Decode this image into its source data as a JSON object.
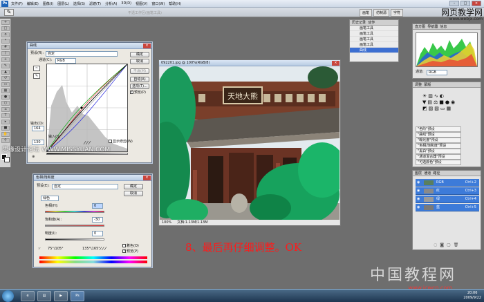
{
  "menubar": {
    "logo": "Ps",
    "menus": [
      "文件(F)",
      "编辑(E)",
      "图像(I)",
      "图层(L)",
      "选择(S)",
      "滤镜(T)",
      "分析(A)",
      "3D(D)",
      "视图(V)",
      "窗口(W)",
      "帮助(H)"
    ],
    "minimize": "–",
    "maximize": "□",
    "close": "×"
  },
  "optbar": {
    "brush_icon": "brush-icon",
    "hint": "不透工作区(画笔工具)",
    "tabs": [
      "画笔",
      "仿制源",
      "字符"
    ]
  },
  "site_watermark": {
    "title": "网页教学网",
    "url": "www.webjx.com"
  },
  "overlay_watermark": "思缘设计论坛 WWW.MISSYUAN.COM",
  "curves": {
    "title": "曲线",
    "preset_label": "预设(R):",
    "preset_value": "自定",
    "channel_label": "通道(C):",
    "channel_value": "RGB",
    "output_label": "输出(O):",
    "output_value": "164",
    "input_label": "输入(I):",
    "input_value": "130",
    "show_clipping": "显示修剪(W)",
    "buttons": {
      "ok": "确定",
      "cancel": "取消",
      "smooth": "平滑(M)",
      "auto": "自动(A)",
      "options": "选项(T)...",
      "preview": "预览(P)"
    }
  },
  "huesat": {
    "title": "色相/饱和度",
    "preset_label": "预设(E):",
    "preset_value": "自定",
    "edit_value": "绿色",
    "hue_label": "色相(H):",
    "hue_value": "0",
    "saturation_label": "饱和度(A):",
    "saturation_value": "-30",
    "lightness_label": "明度(I):",
    "lightness_value": "0",
    "range_left": "75°/105°",
    "range_right": "135°\\165°",
    "colorize": "着色(O)",
    "preview": "预览(P)",
    "buttons": {
      "ok": "确定",
      "cancel": "取消"
    }
  },
  "image_window": {
    "title": "092201.jpg @ 100%(RGB/8)",
    "zoom": "100%",
    "doc_info": "文档:1.13M/1.13M",
    "sign_text": "天地大熊"
  },
  "history": {
    "tabs": [
      "历史记录",
      "动作"
    ],
    "items": [
      "画笔工具",
      "画笔工具",
      "画笔工具",
      "画笔工具",
      "曲线"
    ]
  },
  "histogram": {
    "tabs": [
      "直方图",
      "导航器",
      "信息"
    ],
    "channel_label": "通道:",
    "channel_value": "RGB"
  },
  "adjustments": {
    "tabs": [
      "调整",
      "蒙版"
    ],
    "presets": [
      "\"色阶\"预设",
      "\"曲线\"预设",
      "\"曝光度\"预设",
      "\"色相/饱和度\"预设",
      "\"黑白\"预设",
      "\"通道混合器\"预设",
      "\"可选颜色\"预设"
    ]
  },
  "layers": {
    "tabs": [
      "图层",
      "通道",
      "路径"
    ],
    "rows": [
      {
        "name": "RGB",
        "shortcut": "Ctrl+2"
      },
      {
        "name": "红",
        "shortcut": "Ctrl+3"
      },
      {
        "name": "绿",
        "shortcut": "Ctrl+4"
      },
      {
        "name": "蓝",
        "shortcut": "Ctrl+5"
      }
    ]
  },
  "caption": "8、最后再仔细调整。OK",
  "china_watermark": {
    "text": "中国教程网",
    "domain": "www.jcwcn.com"
  },
  "taskbar": {
    "time": "20:06",
    "date": "2009/9/22"
  },
  "colors": {
    "accent": "#3d6fd1",
    "caption": "#ff1a1a"
  }
}
